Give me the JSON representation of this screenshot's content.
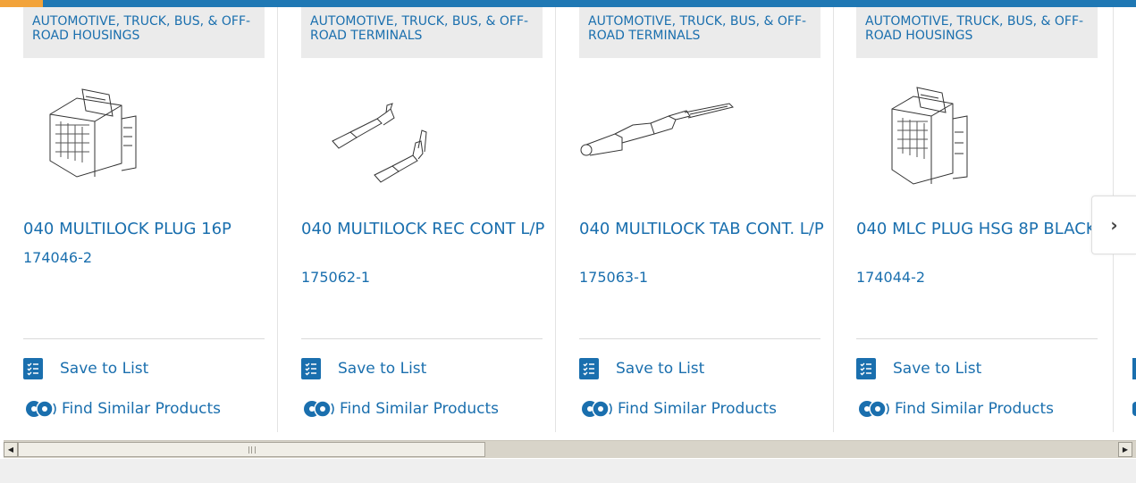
{
  "colors": {
    "brand_blue": "#1a6fae",
    "accent_orange": "#f2a33a",
    "category_bg": "#ebebeb"
  },
  "products": [
    {
      "category": "AUTOMOTIVE, TRUCK, BUS, & OFF-ROAD HOUSINGS",
      "title": "040 MULTILOCK PLUG 16P",
      "part_number": "174046-2",
      "image_icon": "connector-housing-16p-image",
      "save_label": "Save to List",
      "find_label": "Find Similar Products"
    },
    {
      "category": "AUTOMOTIVE, TRUCK, BUS, & OFF-ROAD TERMINALS",
      "title": "040 MULTILOCK REC CONT L/P",
      "part_number": "175062-1",
      "image_icon": "receptacle-terminal-image",
      "save_label": "Save to List",
      "find_label": "Find Similar Products"
    },
    {
      "category": "AUTOMOTIVE, TRUCK, BUS, & OFF-ROAD TERMINALS",
      "title": "040 MULTILOCK TAB CONT. L/P",
      "part_number": "175063-1",
      "image_icon": "tab-terminal-image",
      "save_label": "Save to List",
      "find_label": "Find Similar Products"
    },
    {
      "category": "AUTOMOTIVE, TRUCK, BUS, & OFF-ROAD HOUSINGS",
      "title": "040 MLC PLUG HSG 8P BLACK",
      "part_number": "174044-2",
      "image_icon": "connector-housing-8p-image",
      "save_label": "Save to List",
      "find_label": "Find Similar Products"
    }
  ],
  "carousel": {
    "next_icon": "chevron-right-icon",
    "next_glyph": "›"
  },
  "scrollbar": {
    "left_arrow": "◀",
    "right_arrow": "▶"
  }
}
